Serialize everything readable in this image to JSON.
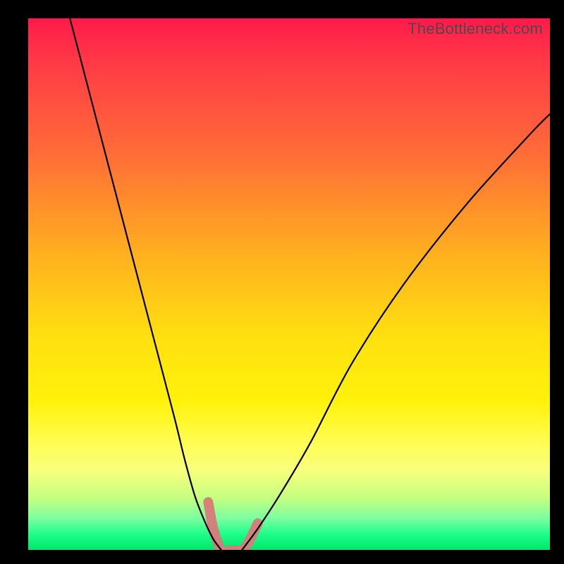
{
  "watermark": "TheBottleneck.com",
  "chart_data": {
    "type": "line",
    "title": "",
    "xlabel": "",
    "ylabel": "",
    "xlim": [
      0,
      100
    ],
    "ylim": [
      0,
      100
    ],
    "grid": false,
    "legend": false,
    "series": [
      {
        "name": "left-curve",
        "x": [
          8,
          12,
          16,
          20,
          24,
          28,
          30,
          32,
          34,
          35.5,
          37
        ],
        "y": [
          100,
          85,
          70,
          55,
          40,
          25,
          17,
          10,
          5,
          2,
          0
        ]
      },
      {
        "name": "right-curve",
        "x": [
          41,
          44,
          48,
          54,
          62,
          72,
          84,
          96,
          100
        ],
        "y": [
          0,
          4,
          10,
          20,
          35,
          50,
          65,
          78,
          82
        ]
      },
      {
        "name": "valley-highlight",
        "x": [
          34.5,
          35.5,
          37,
          39,
          41,
          42.5,
          44
        ],
        "y": [
          9,
          4,
          0,
          0,
          0,
          2,
          5
        ]
      }
    ]
  }
}
